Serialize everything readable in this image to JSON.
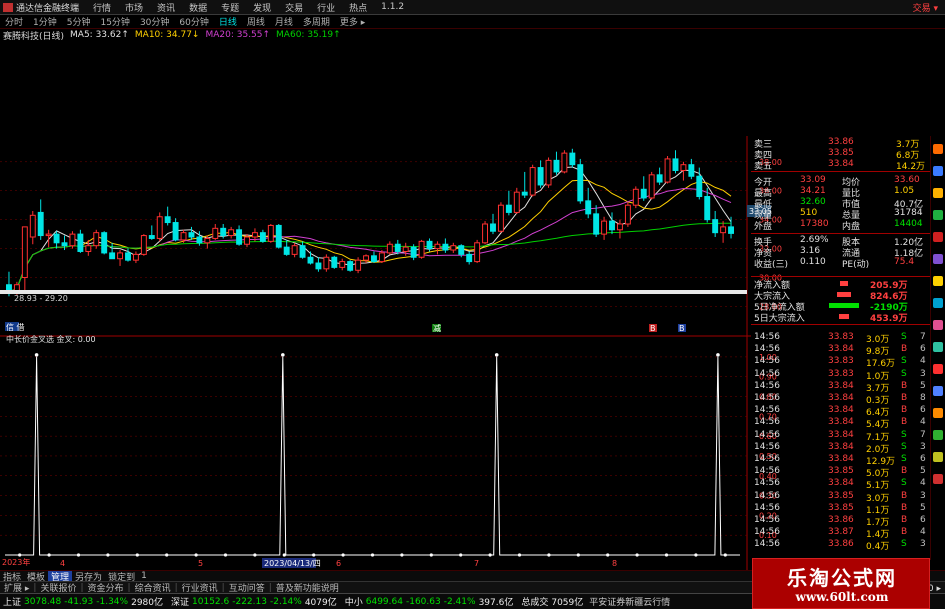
{
  "menu": {
    "app_title": "通达信金融终端",
    "items": [
      "行情",
      "市场",
      "资讯",
      "数据",
      "专题",
      "发现",
      "交易",
      "行业",
      "热点",
      "1.1.2"
    ],
    "trade_label": "交易 ▾"
  },
  "periods": {
    "items": [
      "分时",
      "1分钟",
      "5分钟",
      "15分钟",
      "30分钟",
      "60分钟",
      "日线",
      "周线",
      "月线",
      "多周期",
      "更多 ▸"
    ],
    "active_index": 6
  },
  "ma_bar": {
    "stock": "赛腾科技(日线)",
    "items": [
      {
        "label": "MA5: 33.62↑",
        "color": "#e0e0e0"
      },
      {
        "label": "MA10: 34.77↓",
        "color": "#ffd000"
      },
      {
        "label": "MA20: 35.55↑",
        "color": "#d040d0"
      },
      {
        "label": "MA60: 35.19↑",
        "color": "#00d000"
      }
    ]
  },
  "chart_data": [
    {
      "type": "candlestick",
      "title": "赛腾科技(日线)",
      "yticks": [
        "38.00",
        "36.00",
        "34.00",
        "32.00",
        "30.00",
        "28.00"
      ],
      "ylim": [
        27.2,
        39.3
      ],
      "range_label": "28.93 - 29.20",
      "current_price": "33.05",
      "candles": [
        [
          29.5,
          30.4,
          28.7,
          29.0
        ],
        [
          29.0,
          29.7,
          28.8,
          29.5
        ],
        [
          30.0,
          33.5,
          28.9,
          33.5
        ],
        [
          32.8,
          34.6,
          32.3,
          34.3
        ],
        [
          34.5,
          35.4,
          32.6,
          32.9
        ],
        [
          32.9,
          33.3,
          32.1,
          33.0
        ],
        [
          33.0,
          33.2,
          32.0,
          32.4
        ],
        [
          32.4,
          32.9,
          31.9,
          32.2
        ],
        [
          32.2,
          33.2,
          32.0,
          33.0
        ],
        [
          33.0,
          33.3,
          31.7,
          31.8
        ],
        [
          31.8,
          32.6,
          31.5,
          32.2
        ],
        [
          32.2,
          33.3,
          32.0,
          33.1
        ],
        [
          33.1,
          33.2,
          31.6,
          31.7
        ],
        [
          31.7,
          32.4,
          31.3,
          31.3
        ],
        [
          31.3,
          31.9,
          30.8,
          31.7
        ],
        [
          31.7,
          32.0,
          31.1,
          31.2
        ],
        [
          31.2,
          31.8,
          31.0,
          31.6
        ],
        [
          31.6,
          33.0,
          31.5,
          32.9
        ],
        [
          32.9,
          33.6,
          32.6,
          32.7
        ],
        [
          32.7,
          34.5,
          32.5,
          34.2
        ],
        [
          34.2,
          34.9,
          33.6,
          33.8
        ],
        [
          33.8,
          34.1,
          32.5,
          32.6
        ],
        [
          32.6,
          33.3,
          32.4,
          33.1
        ],
        [
          33.1,
          33.5,
          32.6,
          32.8
        ],
        [
          32.8,
          33.2,
          32.2,
          32.4
        ],
        [
          32.4,
          32.9,
          32.0,
          32.7
        ],
        [
          32.7,
          33.7,
          32.6,
          33.4
        ],
        [
          33.4,
          33.7,
          32.7,
          32.9
        ],
        [
          32.9,
          33.5,
          32.7,
          33.3
        ],
        [
          33.3,
          33.6,
          32.2,
          32.3
        ],
        [
          32.3,
          33.0,
          32.1,
          32.8
        ],
        [
          32.8,
          33.4,
          32.5,
          33.1
        ],
        [
          33.1,
          33.3,
          32.4,
          32.5
        ],
        [
          32.5,
          33.7,
          32.4,
          33.6
        ],
        [
          33.6,
          33.7,
          32.0,
          32.1
        ],
        [
          32.1,
          32.6,
          31.5,
          31.6
        ],
        [
          31.6,
          32.4,
          31.4,
          32.2
        ],
        [
          32.2,
          32.5,
          31.3,
          31.4
        ],
        [
          31.4,
          31.8,
          30.9,
          31.0
        ],
        [
          31.0,
          31.4,
          30.4,
          30.6
        ],
        [
          30.6,
          31.6,
          30.4,
          31.4
        ],
        [
          31.4,
          31.5,
          30.6,
          30.7
        ],
        [
          30.7,
          31.3,
          30.5,
          31.1
        ],
        [
          31.1,
          31.2,
          30.4,
          30.5
        ],
        [
          30.5,
          31.4,
          30.3,
          31.2
        ],
        [
          31.2,
          31.6,
          31.0,
          31.5
        ],
        [
          31.5,
          31.8,
          31.0,
          31.1
        ],
        [
          31.1,
          31.9,
          31.0,
          31.7
        ],
        [
          31.7,
          32.5,
          31.6,
          32.3
        ],
        [
          32.3,
          32.6,
          31.6,
          31.8
        ],
        [
          31.8,
          32.4,
          31.5,
          32.1
        ],
        [
          32.1,
          32.3,
          31.2,
          31.4
        ],
        [
          31.4,
          32.6,
          31.3,
          32.5
        ],
        [
          32.5,
          32.7,
          31.8,
          32.0
        ],
        [
          32.0,
          32.5,
          31.6,
          32.3
        ],
        [
          32.3,
          32.7,
          31.7,
          31.9
        ],
        [
          31.9,
          32.4,
          31.7,
          32.2
        ],
        [
          32.2,
          32.3,
          31.4,
          31.6
        ],
        [
          31.6,
          31.8,
          30.9,
          31.1
        ],
        [
          31.1,
          32.6,
          31.0,
          32.4
        ],
        [
          32.4,
          33.9,
          32.3,
          33.7
        ],
        [
          33.7,
          34.4,
          33.0,
          33.2
        ],
        [
          33.2,
          35.2,
          33.1,
          35.0
        ],
        [
          35.0,
          36.0,
          34.3,
          34.5
        ],
        [
          34.5,
          36.2,
          34.4,
          35.9
        ],
        [
          35.9,
          37.3,
          35.5,
          35.7
        ],
        [
          35.7,
          37.8,
          35.6,
          37.6
        ],
        [
          37.6,
          38.1,
          36.2,
          36.4
        ],
        [
          36.4,
          38.3,
          36.2,
          38.1
        ],
        [
          38.1,
          38.7,
          37.1,
          37.3
        ],
        [
          37.3,
          38.8,
          37.2,
          38.6
        ],
        [
          38.6,
          38.9,
          37.6,
          37.8
        ],
        [
          37.8,
          38.2,
          35.1,
          35.3
        ],
        [
          35.3,
          36.2,
          34.1,
          34.4
        ],
        [
          34.4,
          35.0,
          32.8,
          33.0
        ],
        [
          33.0,
          34.2,
          32.6,
          33.9
        ],
        [
          33.9,
          34.5,
          33.0,
          33.3
        ],
        [
          33.3,
          34.0,
          32.7,
          33.7
        ],
        [
          33.7,
          35.2,
          33.5,
          35.0
        ],
        [
          35.0,
          36.3,
          34.8,
          36.1
        ],
        [
          36.1,
          37.0,
          35.3,
          35.5
        ],
        [
          35.5,
          37.3,
          35.4,
          37.1
        ],
        [
          37.1,
          37.6,
          36.4,
          36.6
        ],
        [
          36.6,
          38.4,
          36.5,
          38.2
        ],
        [
          38.2,
          38.8,
          37.2,
          37.4
        ],
        [
          37.4,
          38.0,
          36.7,
          37.8
        ],
        [
          37.8,
          38.2,
          36.8,
          37.0
        ],
        [
          37.0,
          37.6,
          35.4,
          35.6
        ],
        [
          35.6,
          36.2,
          33.8,
          34.0
        ],
        [
          34.0,
          34.6,
          32.8,
          33.1
        ],
        [
          33.1,
          33.9,
          32.4,
          33.5
        ],
        [
          33.5,
          34.2,
          32.7,
          33.05
        ]
      ]
    },
    {
      "type": "line",
      "title": "中长价金叉选 金叉: 0.00",
      "yticks": [
        "1.00",
        "0.90",
        "0.80",
        "0.70",
        "0.60",
        "0.50",
        "0.40",
        "0.30",
        "0.20",
        "0.10"
      ],
      "ylim": [
        0,
        1.05
      ],
      "spike_positions": [
        0.043,
        0.378,
        0.669,
        0.97
      ],
      "dot_count": 25,
      "date_label": "2023/04/13/四",
      "left_label": "2023年",
      "mark_labels": [
        "4",
        "5",
        "6",
        "7",
        "8"
      ]
    }
  ],
  "info_marks": {
    "left": "信 借",
    "mid": "减",
    "r1": "B",
    "r2": "B"
  },
  "quote": {
    "order_rows": [
      {
        "label": "卖三",
        "price": "33.86",
        "vol": "3.7万"
      },
      {
        "label": "卖四",
        "price": "33.85",
        "vol": "6.8万"
      },
      {
        "label": "卖五",
        "price": "33.84",
        "vol": "14.2万"
      }
    ],
    "stats": [
      {
        "l1": "今开",
        "v1": "33.09",
        "l2": "均价",
        "v2": "33.60"
      },
      {
        "l1": "最高",
        "v1": "34.21",
        "l2": "量比",
        "v2": "1.05"
      },
      {
        "l1": "最低",
        "v1": "32.60",
        "l2": "市值",
        "v2": "40.7亿"
      },
      {
        "l1": "现量",
        "v1": "510",
        "l2": "总量",
        "v2": "31784"
      },
      {
        "l1": "外盘",
        "v1": "17380",
        "l2": "内盘",
        "v2": "14404"
      },
      {
        "l1": "换手",
        "v1": "2.69%",
        "l2": "股本",
        "v2": "1.20亿"
      },
      {
        "l1": "净资",
        "v1": "3.16",
        "l2": "流通",
        "v2": "1.18亿"
      },
      {
        "l1": "收益(三)",
        "v1": "0.110",
        "l2": "PE(动)",
        "v2": "75.4"
      }
    ],
    "flow": [
      {
        "label": "净流入额",
        "value": "205.9万"
      },
      {
        "label": "大宗流入",
        "value": "824.6万"
      },
      {
        "label": "5日净流入额",
        "value": "-2190万"
      },
      {
        "label": "5日大宗流入",
        "value": "453.9万"
      }
    ],
    "trades": [
      {
        "t": "14:56",
        "p": "33.83",
        "v": "3.0万",
        "f": "S",
        "n": "7"
      },
      {
        "t": "14:56",
        "p": "33.84",
        "v": "9.8万",
        "f": "B",
        "n": "6"
      },
      {
        "t": "14:56",
        "p": "33.83",
        "v": "17.6万",
        "f": "S",
        "n": "4"
      },
      {
        "t": "14:56",
        "p": "33.83",
        "v": "1.0万",
        "f": "S",
        "n": "3"
      },
      {
        "t": "14:56",
        "p": "33.84",
        "v": "3.7万",
        "f": "B",
        "n": "5"
      },
      {
        "t": "14:56",
        "p": "33.84",
        "v": "0.3万",
        "f": "B",
        "n": "8"
      },
      {
        "t": "14:56",
        "p": "33.84",
        "v": "6.4万",
        "f": "B",
        "n": "6"
      },
      {
        "t": "14:56",
        "p": "33.84",
        "v": "5.4万",
        "f": "B",
        "n": "4"
      },
      {
        "t": "14:56",
        "p": "33.84",
        "v": "7.1万",
        "f": "S",
        "n": "7"
      },
      {
        "t": "14:56",
        "p": "33.84",
        "v": "2.0万",
        "f": "S",
        "n": "3"
      },
      {
        "t": "14:56",
        "p": "33.84",
        "v": "12.9万",
        "f": "S",
        "n": "6"
      },
      {
        "t": "14:56",
        "p": "33.85",
        "v": "5.0万",
        "f": "B",
        "n": "5"
      },
      {
        "t": "14:56",
        "p": "33.84",
        "v": "5.1万",
        "f": "S",
        "n": "4"
      },
      {
        "t": "14:56",
        "p": "33.85",
        "v": "3.0万",
        "f": "B",
        "n": "3"
      },
      {
        "t": "14:56",
        "p": "33.85",
        "v": "1.1万",
        "f": "B",
        "n": "5"
      },
      {
        "t": "14:56",
        "p": "33.86",
        "v": "1.7万",
        "f": "B",
        "n": "6"
      },
      {
        "t": "14:56",
        "p": "33.87",
        "v": "1.4万",
        "f": "B",
        "n": "4"
      },
      {
        "t": "14:56",
        "p": "33.86",
        "v": "0.4万",
        "f": "S",
        "n": "3"
      }
    ]
  },
  "tabs": {
    "row1": [
      "指标",
      "模板",
      "管理",
      "另存为",
      "锁定到",
      "1"
    ],
    "row2": [
      "扩展 ▸",
      "关联报价",
      "资金分布",
      "综合资讯",
      "行业资讯",
      "互动问答",
      "普及新功能说明"
    ],
    "right_label": "图文 F10 ▸"
  },
  "status": {
    "items": [
      {
        "name": "上证",
        "val": "3078.48",
        "chg": "-41.93",
        "pct": "-1.34%",
        "amt": "2980亿"
      },
      {
        "name": "深证",
        "val": "10152.6",
        "chg": "-222.13",
        "pct": "-2.14%",
        "amt": "4079亿"
      },
      {
        "name": "中小",
        "val": "6499.64",
        "chg": "-160.63",
        "pct": "-2.41%",
        "amt": "397.6亿"
      }
    ],
    "total_label": "总成交",
    "total_value": "7059亿",
    "broker": "平安证券新疆云行情"
  },
  "watermark": {
    "line1": "乐淘公式网",
    "line2": "www.60lt.com"
  },
  "colors": {
    "up": "#ff3030",
    "down": "#00e5e5",
    "ma5": "#e0e0e0",
    "ma10": "#ffd000",
    "ma20": "#d040d0",
    "ma60": "#00d000",
    "grid": "#7a0000"
  }
}
